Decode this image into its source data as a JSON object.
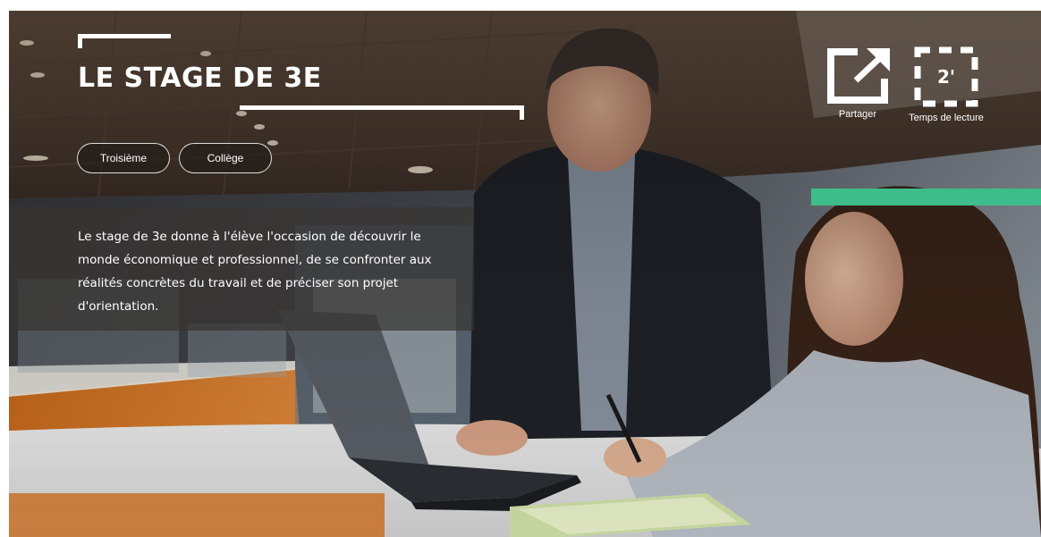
{
  "hero": {
    "title": "LE STAGE DE 3E",
    "tags": [
      "Troisième",
      "Collège"
    ],
    "description": "Le stage de 3e donne à l'élève l'occasion de découvrir le monde économique et professionnel, de se confronter aux réalités concrètes du travail et de préciser son projet d'orientation."
  },
  "actions": {
    "share_label": "Partager",
    "share_icon": "share-icon",
    "reading_time_value": "2'",
    "reading_time_label": "Temps de lecture",
    "reading_time_icon": "timer-frame-icon"
  },
  "colors": {
    "accent": "#3dbd8a",
    "title_text": "#ffffff",
    "overlay": "#373432"
  }
}
